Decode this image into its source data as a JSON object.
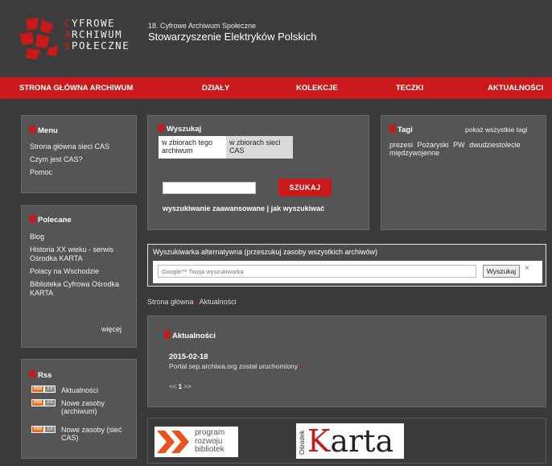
{
  "header": {
    "logo_lines": [
      {
        "first": "C",
        "rest": "YFROWE"
      },
      {
        "first": "A",
        "rest": "RCHIWUM"
      },
      {
        "first": "S",
        "rest": "POŁECZNE"
      }
    ],
    "subtitle": "18. Cyfrowe Archiwum Społeczne",
    "title": "Stowarzyszenie Elektryków Polskich"
  },
  "nav": {
    "home": "STRONA GŁÓWNA ARCHIWUM",
    "sections": "DZIAŁY",
    "collections": "KOLEKCJE",
    "folders": "TECZKI",
    "news": "AKTUALNOŚCI"
  },
  "menu": {
    "title": "Menu",
    "items": [
      "Strona główna sieci CAS",
      "Czym jest CAS?",
      "Pomoc"
    ]
  },
  "recommended": {
    "title": "Polecane",
    "items": [
      "Blog",
      "Historia XX wieku - serwis Ośrodka KARTA",
      "Polacy na Wschodzie",
      "Biblioteka Cyfrowa Ośrodka KARTA"
    ],
    "more": "więcej"
  },
  "rss": {
    "title": "Rss",
    "badge_left": "RSS",
    "badge_right": "2.0",
    "items": [
      "Aktualności",
      "Nowe zasoby (archiwum)",
      "Nowe zasoby (sieć CAS)"
    ]
  },
  "search": {
    "title": "Wyszukaj",
    "tab_local": "w zbiorach tego archiwum",
    "tab_network": "w zbiorach sieci CAS",
    "input_value": "",
    "button": "SZUKAJ",
    "advanced": "wyszukiwanie zaawansowane | jak wyszukiwać"
  },
  "tags": {
    "title": "Tagi",
    "show_all": "pokaż wszystkie tagi",
    "items": [
      "prezesi",
      "Pożaryski",
      "PW",
      "dwudziestolecie międzywojenne"
    ]
  },
  "alt_search": {
    "title": "Wyszukiwarka alternatywna (przeszukuj zasoby wszystkich archiwów)",
    "placeholder": "Google™ Twoja wyszukiwarka",
    "button": "Wyszukaj",
    "close": "×"
  },
  "breadcrumb": {
    "home": "Strona główna",
    "separator": "»",
    "current": "Aktualności"
  },
  "news": {
    "title": "Aktualności",
    "date": "2015-02-18",
    "text": "Portal sep.archiwa.org został uruchomiony",
    "text_arrow": "»",
    "pager_prev": "<<",
    "pager_current": "1",
    "pager_next": ">>"
  },
  "partners": {
    "p1_lines": [
      "program",
      "rozwoju",
      "bibliotek"
    ],
    "p2_small": "Ośrodek",
    "p2_big_k": "K",
    "p2_big_rest": "arta"
  },
  "colors": {
    "accent": "#c9191b",
    "background": "#3a3a3a",
    "panel": "#555555"
  }
}
